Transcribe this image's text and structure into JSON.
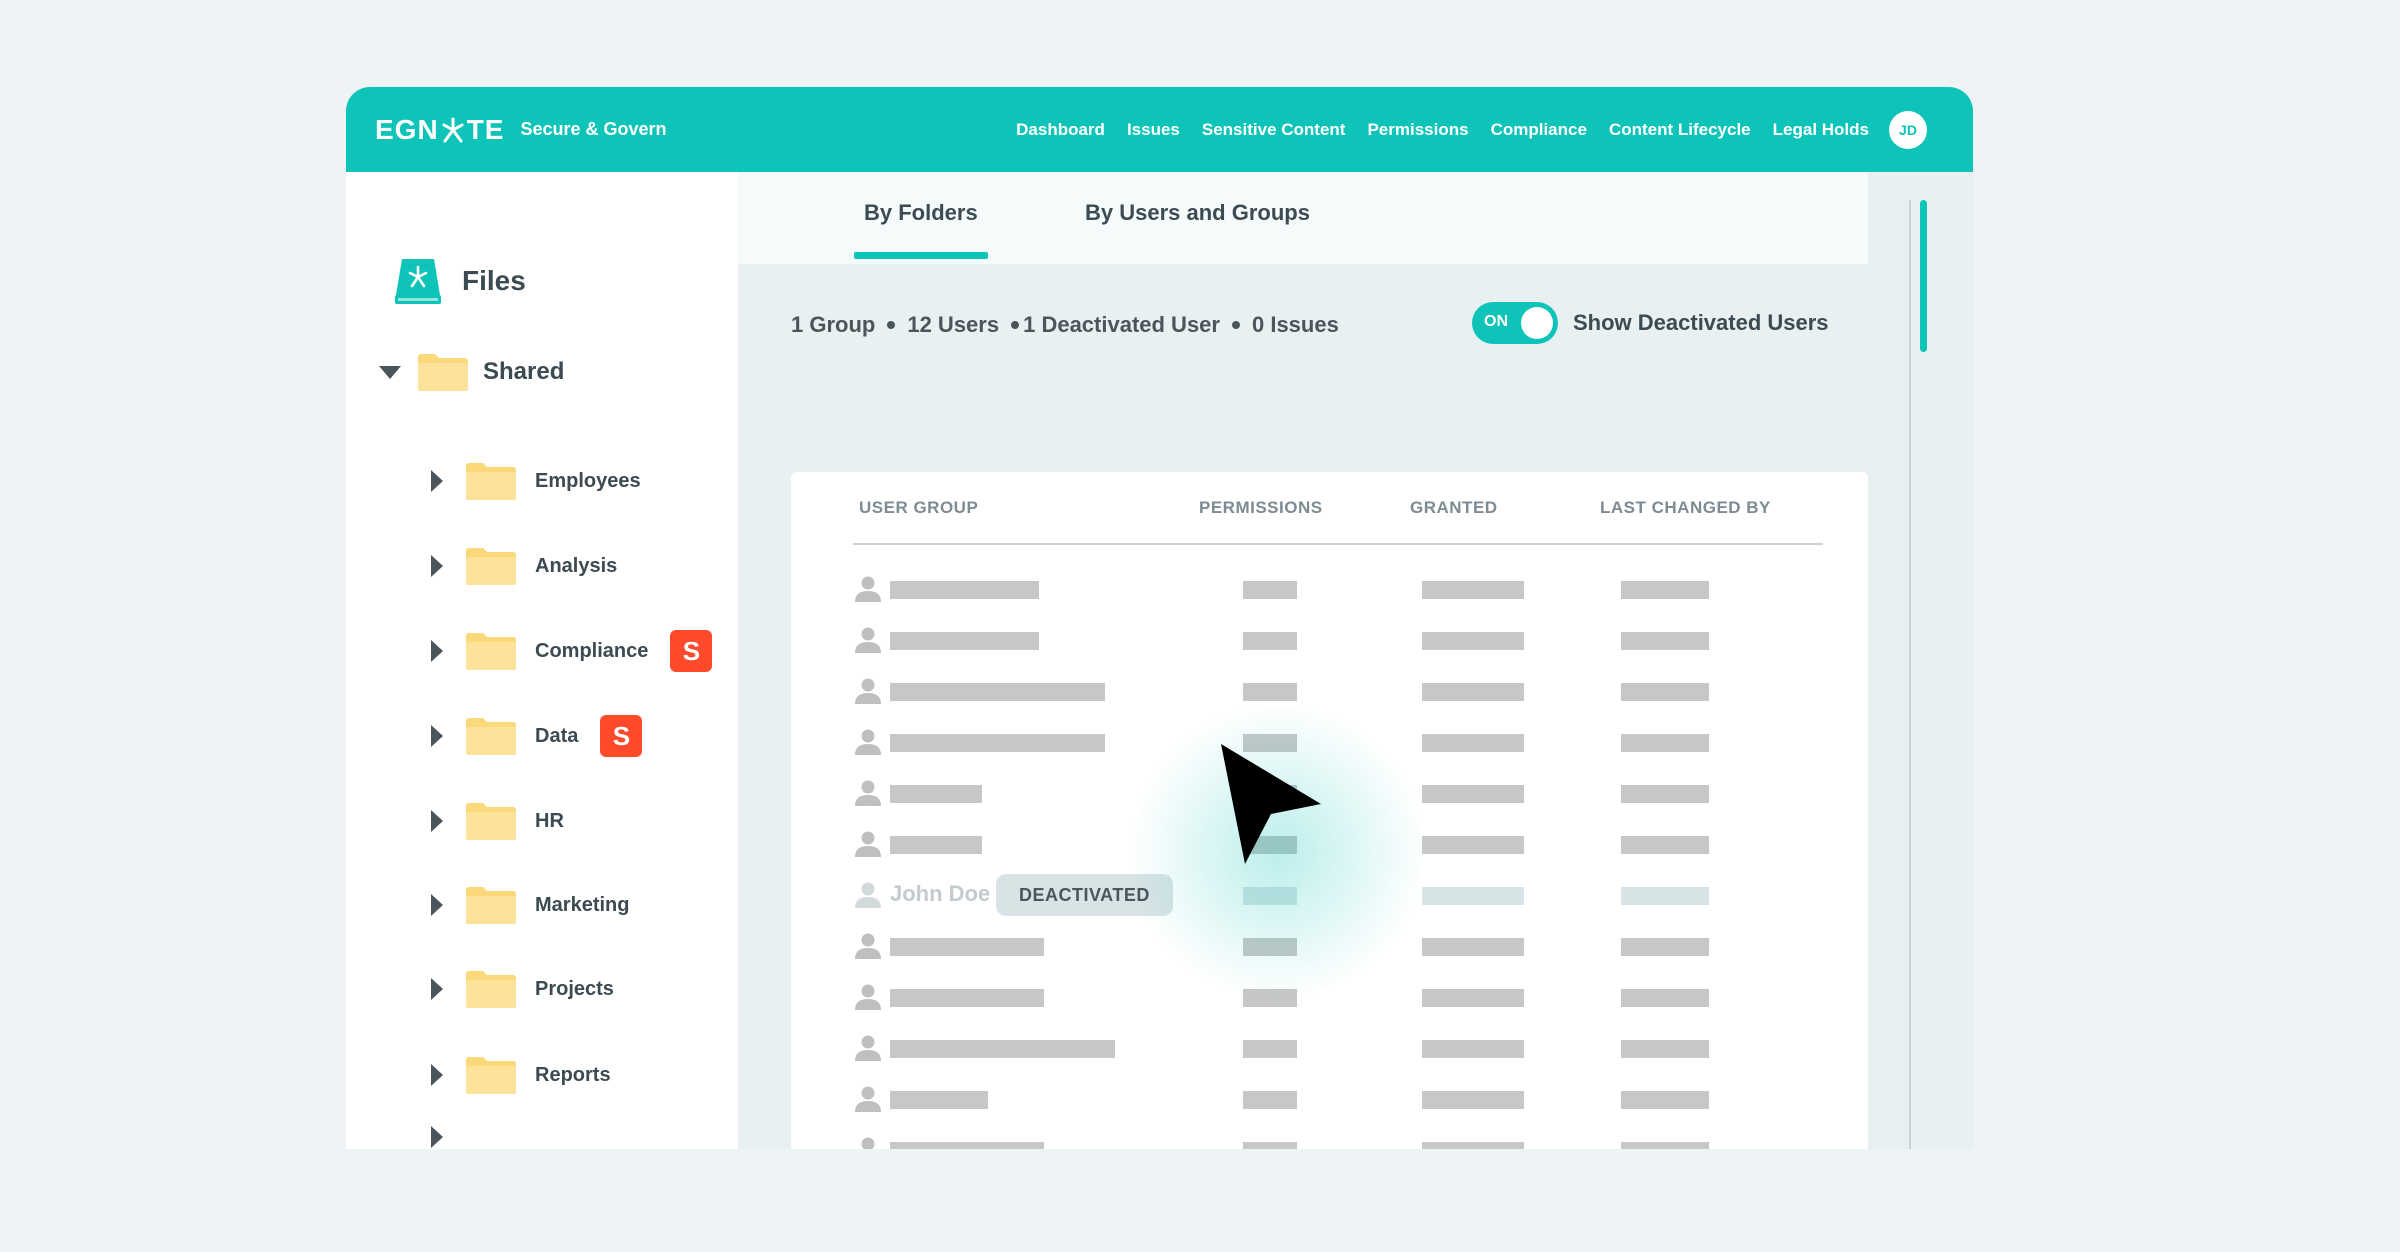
{
  "header": {
    "logo_text": "EGNYTE",
    "product": "Secure & Govern",
    "nav": [
      "Dashboard",
      "Issues",
      "Sensitive Content",
      "Permissions",
      "Compliance",
      "Content Lifecycle",
      "Legal Holds"
    ],
    "avatar_initials": "JD"
  },
  "sidebar": {
    "title": "Files",
    "root": "Shared",
    "folders": [
      {
        "label": "Employees",
        "badge": ""
      },
      {
        "label": "Analysis",
        "badge": ""
      },
      {
        "label": "Compliance",
        "badge": "S"
      },
      {
        "label": "Data",
        "badge": "S"
      },
      {
        "label": "HR",
        "badge": ""
      },
      {
        "label": "Marketing",
        "badge": ""
      },
      {
        "label": "Projects",
        "badge": ""
      },
      {
        "label": "Reports",
        "badge": ""
      }
    ]
  },
  "tabs": [
    "By Folders",
    "By Users and Groups"
  ],
  "summary": {
    "groups": "1 Group",
    "users": "12 Users",
    "deactivated": "1 Deactivated User",
    "issues": "0 Issues"
  },
  "toggle": {
    "state": "ON",
    "label": "Show Deactivated Users"
  },
  "table": {
    "headers": [
      "USER GROUP",
      "PERMISSIONS",
      "GRANTED",
      "LAST CHANGED BY"
    ],
    "deactivated_user": "John Doe",
    "deactivated_badge": "DEACTIVATED"
  },
  "colors": {
    "accent": "#0ec4b8",
    "badge": "#ff4b2b",
    "folder": "#fbd97a"
  }
}
